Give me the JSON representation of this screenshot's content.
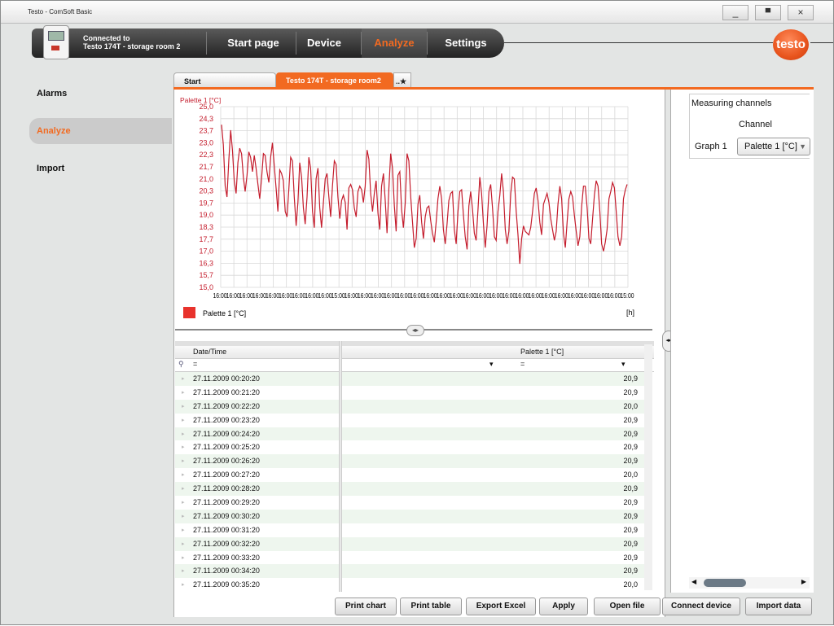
{
  "window": {
    "title": "Testo - ComSoft Basic",
    "min": "_",
    "max": "▀",
    "close": "×"
  },
  "header": {
    "connected_label": "Connected to",
    "connected_device": "Testo 174T - storage room 2",
    "logo": "testo"
  },
  "nav": [
    {
      "label": "Start page"
    },
    {
      "label": "Device"
    },
    {
      "label": "Analyze"
    },
    {
      "label": "Settings"
    }
  ],
  "sidebar": [
    {
      "label": "Alarms"
    },
    {
      "label": "Analyze"
    },
    {
      "label": "Import"
    }
  ],
  "tabs": {
    "start": "Start",
    "active": "Testo 174T - storage room2",
    "new": "..★"
  },
  "chart_data": {
    "type": "line",
    "title": "Palette 1 [°C]",
    "ylabel": "Palette 1 [°C]",
    "ylim": [
      15.0,
      25.0
    ],
    "yticks": [
      "25,0",
      "24,3",
      "23,7",
      "23,0",
      "22,3",
      "21,7",
      "21,0",
      "20,3",
      "19,7",
      "19,0",
      "18,3",
      "17,7",
      "17,0",
      "16,3",
      "15,7",
      "15,0"
    ],
    "xticks": [
      "16:00",
      "16:00",
      "16:00",
      "16:00",
      "16:00",
      "16:00",
      "16:00",
      "16:00",
      "16:00",
      "15:00",
      "16:00",
      "16:00",
      "16:00",
      "16:00",
      "16:00",
      "16:00",
      "16:00",
      "16:00",
      "16:00",
      "16:00",
      "16:00",
      "16:00",
      "16:00",
      "16:00",
      "16:00",
      "16:00",
      "16:00",
      "16:00",
      "16:00",
      "16:00",
      "16:00",
      "15:00"
    ],
    "legend": "Palette 1 [°C]",
    "legend_unit": "[h]",
    "series": [
      {
        "name": "Palette 1 [°C]",
        "color": "#c41c2c",
        "values": [
          24.0,
          22.9,
          20.6,
          20.0,
          22.0,
          23.7,
          22.6,
          20.9,
          20.2,
          21.9,
          22.7,
          22.4,
          21.1,
          20.3,
          21.2,
          22.5,
          22.2,
          21.4,
          22.3,
          21.6,
          20.7,
          19.9,
          21.0,
          22.4,
          22.3,
          21.4,
          20.8,
          22.2,
          23.0,
          21.7,
          20.5,
          19.2,
          21.5,
          21.3,
          20.9,
          19.2,
          18.9,
          20.4,
          22.2,
          22.0,
          20.0,
          18.4,
          19.7,
          21.9,
          21.1,
          19.4,
          18.5,
          20.0,
          22.2,
          21.6,
          19.2,
          18.3,
          21.0,
          21.6,
          19.4,
          18.3,
          19.7,
          21.0,
          21.3,
          20.0,
          18.9,
          20.6,
          22.0,
          21.8,
          20.0,
          18.8,
          19.8,
          20.1,
          19.7,
          18.2,
          20.5,
          20.7,
          20.4,
          19.4,
          18.9,
          20.3,
          20.6,
          20.4,
          19.7,
          20.6,
          22.6,
          22.1,
          20.2,
          19.2,
          20.2,
          20.9,
          19.1,
          18.2,
          20.6,
          21.3,
          19.8,
          18.0,
          20.5,
          22.4,
          21.6,
          19.5,
          18.1,
          21.2,
          21.4,
          19.3,
          18.3,
          19.7,
          22.4,
          22.0,
          20.0,
          18.6,
          17.2,
          17.7,
          19.6,
          20.1,
          18.6,
          17.7,
          18.9,
          19.4,
          19.5,
          18.7,
          18.0,
          17.5,
          18.6,
          19.9,
          20.6,
          19.9,
          18.2,
          17.4,
          18.5,
          19.8,
          20.2,
          20.3,
          18.2,
          17.4,
          19.2,
          20.3,
          20.4,
          19.0,
          17.8,
          17.1,
          19.5,
          20.3,
          19.3,
          18.0,
          17.6,
          19.3,
          21.1,
          20.2,
          18.5,
          17.2,
          18.4,
          20.3,
          20.7,
          19.4,
          17.8,
          17.6,
          19.2,
          20.1,
          21.3,
          20.3,
          18.2,
          17.4,
          18.1,
          20.2,
          21.1,
          21.0,
          19.2,
          17.9,
          16.3,
          17.7,
          18.4,
          18.1,
          18.0,
          17.9,
          18.3,
          19.2,
          20.2,
          20.5,
          19.8,
          18.6,
          17.9,
          19.6,
          19.9,
          20.2,
          19.7,
          18.8,
          18.2,
          17.6,
          18.1,
          19.6,
          20.6,
          19.9,
          18.0,
          17.2,
          18.6,
          19.9,
          20.3,
          20.0,
          19.0,
          18.1,
          17.3,
          17.8,
          19.5,
          20.6,
          20.6,
          19.4,
          17.7,
          17.4,
          18.8,
          20.1,
          20.9,
          20.6,
          19.2,
          17.4,
          17.0,
          17.5,
          18.2,
          19.9,
          20.3,
          20.8,
          20.5,
          19.2,
          17.8,
          17.3,
          17.8,
          19.9,
          20.4,
          20.7
        ]
      }
    ]
  },
  "table": {
    "col_datetime": "Date/Time",
    "col_value": "Palette 1 [°C]",
    "filter_symbol": "=",
    "rows": [
      {
        "dt": "27.11.2009 00:20:20",
        "v": "20,9"
      },
      {
        "dt": "27.11.2009 00:21:20",
        "v": "20,9"
      },
      {
        "dt": "27.11.2009 00:22:20",
        "v": "20,0"
      },
      {
        "dt": "27.11.2009 00:23:20",
        "v": "20,9"
      },
      {
        "dt": "27.11.2009 00:24:20",
        "v": "20,9"
      },
      {
        "dt": "27.11.2009 00:25:20",
        "v": "20,9"
      },
      {
        "dt": "27.11.2009 00:26:20",
        "v": "20,9"
      },
      {
        "dt": "27.11.2009 00:27:20",
        "v": "20,0"
      },
      {
        "dt": "27.11.2009 00:28:20",
        "v": "20,9"
      },
      {
        "dt": "27.11.2009 00:29:20",
        "v": "20,9"
      },
      {
        "dt": "27.11.2009 00:30:20",
        "v": "20,9"
      },
      {
        "dt": "27.11.2009 00:31:20",
        "v": "20,9"
      },
      {
        "dt": "27.11.2009 00:32:20",
        "v": "20,9"
      },
      {
        "dt": "27.11.2009 00:33:20",
        "v": "20,9"
      },
      {
        "dt": "27.11.2009 00:34:20",
        "v": "20,9"
      },
      {
        "dt": "27.11.2009 00:35:20",
        "v": "20,0"
      }
    ]
  },
  "buttons": {
    "print_chart": "Print chart",
    "print_table": "Print table",
    "export_excel": "Export Excel",
    "apply": "Apply",
    "open_file": "Open file",
    "connect_device": "Connect device",
    "import_data": "Import data"
  },
  "channels": {
    "header": "Measuring channels",
    "channel": "Channel",
    "graph_label": "Graph 1",
    "graph_value": "Palette 1 [°C]"
  },
  "colors": {
    "accent": "#f26a21",
    "series": "#c41c2c"
  }
}
